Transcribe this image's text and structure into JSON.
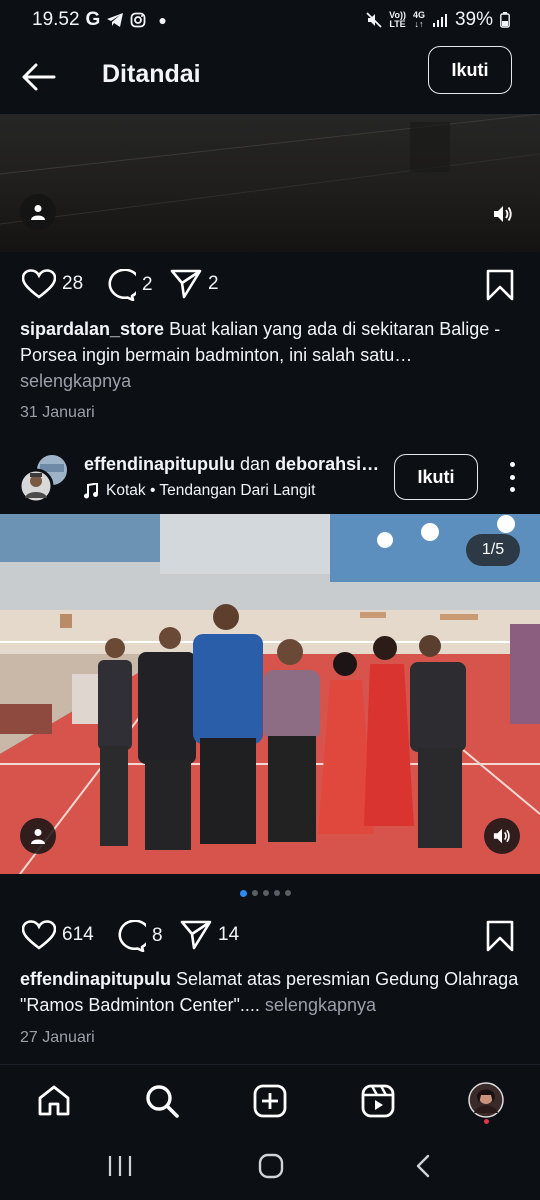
{
  "status_bar": {
    "time": "19.52",
    "notif_icons": [
      "google-g-icon",
      "telegram-icon",
      "instagram-icon",
      "dot-icon"
    ],
    "volte_top": "Vo))",
    "volte_bottom": "LTE",
    "network_top": "4G",
    "network_bottom": "↓↑",
    "battery": "39%"
  },
  "header": {
    "title": "Ditandai",
    "follow_label": "Ikuti"
  },
  "post1": {
    "likes": "28",
    "comments": "2",
    "shares": "2",
    "username": "sipardalan_store",
    "caption": "Buat kalian yang ada di sekitaran Balige - Porsea ingin bermain badminton, ini salah satu…",
    "more_label": "selengkapnya",
    "date": "31 Januari"
  },
  "post2": {
    "user1": "effendinapitupulu",
    "joiner": "dan",
    "user2": "deborahsi…",
    "music": "Kotak • Tendangan Dari Langit",
    "follow_label": "Ikuti",
    "counter": "1/5",
    "likes": "614",
    "comments": "8",
    "shares": "14",
    "username": "effendinapitupulu",
    "caption": "Selamat atas peresmian Gedung Olahraga \"Ramos Badminton Center\"....",
    "more_label": "selengkapnya",
    "date": "27 Januari",
    "carousel_count": 5,
    "carousel_index": 1
  },
  "bottom_nav": [
    "home-icon",
    "search-icon",
    "create-icon",
    "reels-icon",
    "profile-avatar"
  ],
  "colors": {
    "background": "#0c0f14",
    "accent_dot": "#2f8cf5",
    "notification_dot": "#e8334a"
  }
}
